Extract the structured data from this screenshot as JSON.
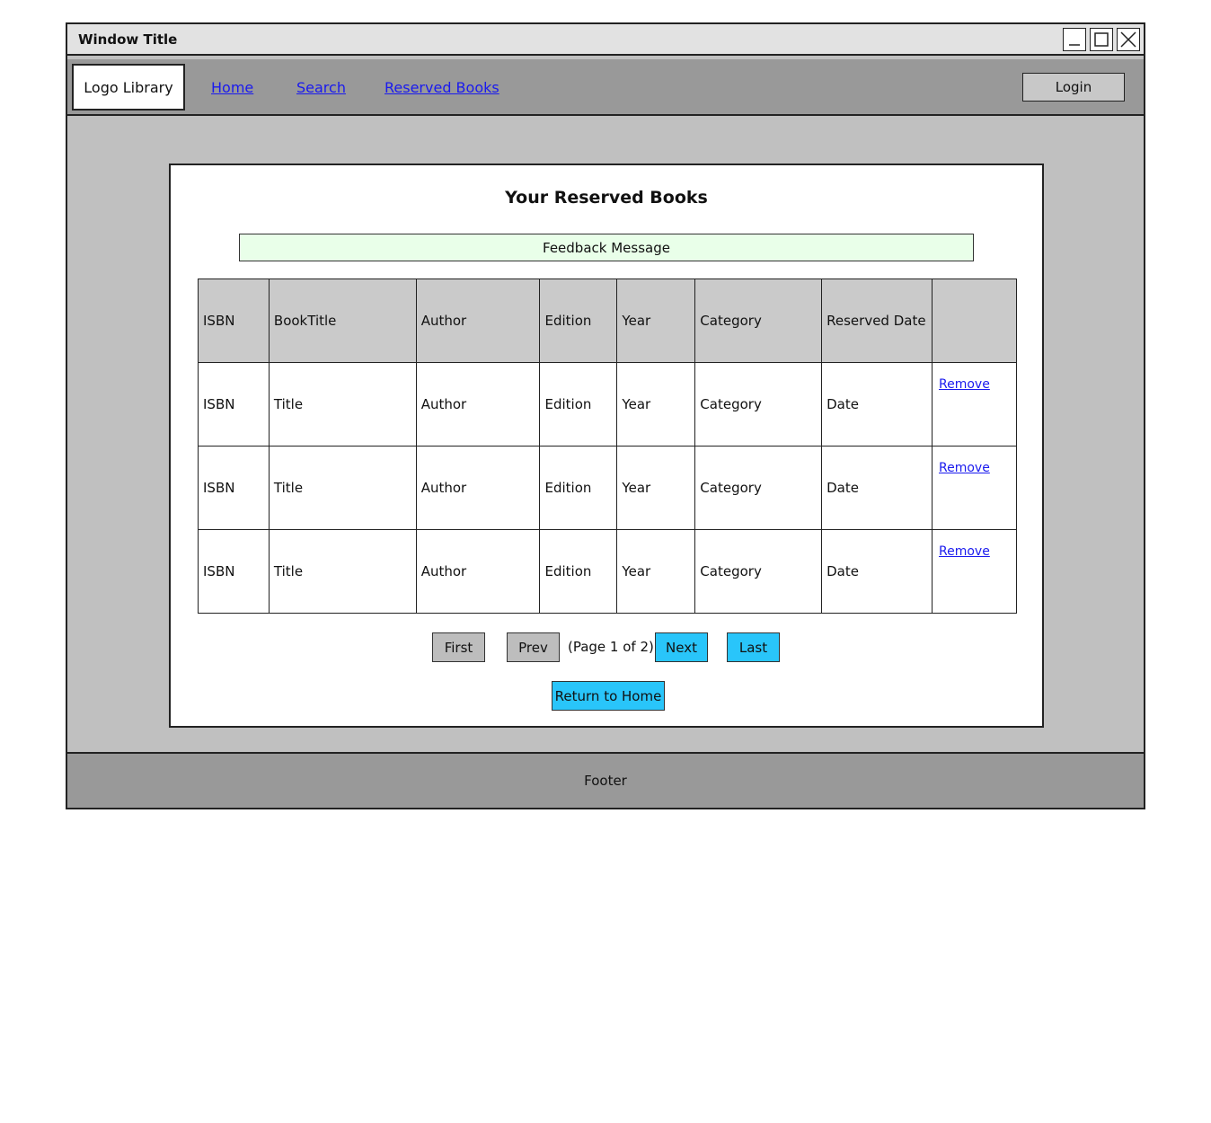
{
  "window": {
    "title": "Window Title"
  },
  "navbar": {
    "logo": "Logo Library",
    "links": [
      "Home",
      "Search",
      "Reserved Books"
    ],
    "login_label": "Login"
  },
  "main": {
    "heading": "Your Reserved Books",
    "feedback": "Feedback Message",
    "table": {
      "headers": [
        "ISBN",
        "BookTitle",
        "Author",
        "Edition",
        "Year",
        "Category",
        "Reserved Date",
        ""
      ],
      "rows": [
        [
          "ISBN",
          "Title",
          "Author",
          "Edition",
          "Year",
          "Category",
          "Date",
          "Remove"
        ],
        [
          "ISBN",
          "Title",
          "Author",
          "Edition",
          "Year",
          "Category",
          "Date",
          "Remove"
        ],
        [
          "ISBN",
          "Title",
          "Author",
          "Edition",
          "Year",
          "Category",
          "Date",
          "Remove"
        ]
      ]
    },
    "pagination": {
      "first": "First",
      "prev": "Prev",
      "info": "(Page 1 of 2)",
      "next": "Next",
      "last": "Last"
    },
    "return_home": "Return to Home"
  },
  "footer": {
    "text": "Footer"
  },
  "colors": {
    "window_bg": "#c0c0c0",
    "navbar_bg": "#999999",
    "feedback_bg": "#e9ffe9",
    "accent_button": "#29c5fa",
    "gray_button": "#bdbdbd",
    "link": "#1a1aee"
  }
}
